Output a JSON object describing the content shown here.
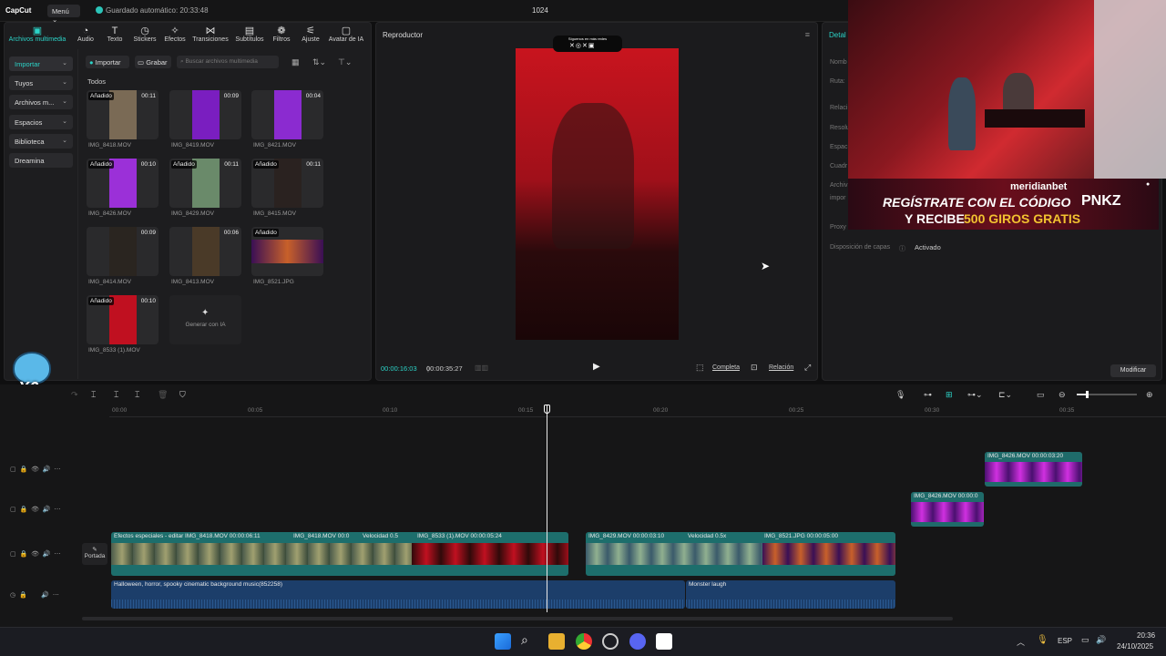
{
  "app": {
    "logo": "CapCut",
    "menu_label": "Menú",
    "autosave": "Guardado automático: 20:33:48",
    "project_title": "1024"
  },
  "toolbar": {
    "items": [
      {
        "label": "Archivos multimedia",
        "icon": "media-icon"
      },
      {
        "label": "Audio",
        "icon": "audio-icon"
      },
      {
        "label": "Texto",
        "icon": "text-icon"
      },
      {
        "label": "Stickers",
        "icon": "sticker-icon"
      },
      {
        "label": "Efectos",
        "icon": "effects-icon"
      },
      {
        "label": "Transiciones",
        "icon": "transitions-icon"
      },
      {
        "label": "Subtítulos",
        "icon": "subtitles-icon"
      },
      {
        "label": "Filtros",
        "icon": "filters-icon"
      },
      {
        "label": "Ajuste",
        "icon": "adjust-icon"
      },
      {
        "label": "Avatar de IA",
        "icon": "avatar-icon"
      }
    ]
  },
  "sidebar": {
    "items": [
      {
        "label": "Importar"
      },
      {
        "label": "Tuyos"
      },
      {
        "label": "Archivos m..."
      },
      {
        "label": "Espacios"
      },
      {
        "label": "Biblioteca"
      },
      {
        "label": "Dreamina"
      }
    ]
  },
  "media": {
    "import_label": "Importar",
    "record_label": "Grabar",
    "search_placeholder": "Buscar archivos multimedia",
    "section": "Todos",
    "added_tag": "Añadido",
    "generate_ai": "Generar con IA",
    "items": [
      {
        "name": "IMG_8418.MOV",
        "duration": "00:11",
        "added": true,
        "color": "#7a6a55"
      },
      {
        "name": "IMG_8419.MOV",
        "duration": "00:09",
        "added": false,
        "color": "#7a1ec0"
      },
      {
        "name": "IMG_8421.MOV",
        "duration": "00:04",
        "added": false,
        "color": "#8b2bd0"
      },
      {
        "name": "IMG_8426.MOV",
        "duration": "00:10",
        "added": true,
        "color": "#9b30d8"
      },
      {
        "name": "IMG_8429.MOV",
        "duration": "00:11",
        "added": true,
        "color": "#6a8a6a"
      },
      {
        "name": "IMG_8415.MOV",
        "duration": "00:11",
        "added": true,
        "color": "#2a2220"
      },
      {
        "name": "IMG_8414.MOV",
        "duration": "00:09",
        "added": false,
        "color": "#2a2520"
      },
      {
        "name": "IMG_8413.MOV",
        "duration": "00:06",
        "added": false,
        "color": "#4a3a28"
      },
      {
        "name": "IMG_8521.JPG",
        "duration": "",
        "added": true,
        "color": "#5a1a6a"
      },
      {
        "name": "IMG_8533 (1).MOV",
        "duration": "00:10",
        "added": true,
        "color": "#c01020"
      }
    ]
  },
  "player": {
    "title": "Reproductor",
    "current_time": "00:00:16:03",
    "total_time": "00:00:35:27",
    "complete_label": "Completa",
    "ratio_label": "Relación",
    "overlay_text": "Síguenos en más redes"
  },
  "details": {
    "title": "Detal",
    "labels": [
      "Nomb",
      "Ruta:",
      "Relaci",
      "Resolu",
      "Espac",
      "Cuadr",
      "Archiv",
      "impor",
      "Proxy"
    ],
    "layout_label": "Disposición de capas",
    "layout_value": "Activado",
    "modify_button": "Modificar"
  },
  "ad": {
    "brand": "meridianbet",
    "line1": "REGÍSTRATE CON EL CÓDIGO",
    "code": "PNKZ",
    "line2_a": "Y RECIBE",
    "line2_b": "500 GIROS GRATIS"
  },
  "sticker": {
    "multiplier": "X6"
  },
  "timeline": {
    "ruler": [
      "00:00",
      "00:05",
      "00:10",
      "00:15",
      "00:20",
      "00:25",
      "00:30",
      "00:35"
    ],
    "cover_label": "Portada",
    "clips": {
      "main_a": "Efectos especiales - editar  IMG_8418.MOV  00:00:06:11",
      "main_b": "IMG_8418.MOV  00:0",
      "main_c": "Velocidad 0.5",
      "main_d": "IMG_8533 (1).MOV  00:00:05:24",
      "main_e": "IMG_8429.MOV  00:00:03:10",
      "main_f": "Velocidad 0.5x",
      "main_g": "IMG_8521.JPG  00:00:05:00",
      "ov1": "IMG_8426.MOV  00:00:03:20",
      "ov2": "IMG_8426.MOV  00:00:0",
      "audio1": "Halloween, horror, spooky cinematic background music(852258)",
      "audio2": "Monster laugh"
    }
  },
  "taskbar": {
    "lang": "ESP",
    "time": "20:36",
    "date": "24/10/2025"
  }
}
